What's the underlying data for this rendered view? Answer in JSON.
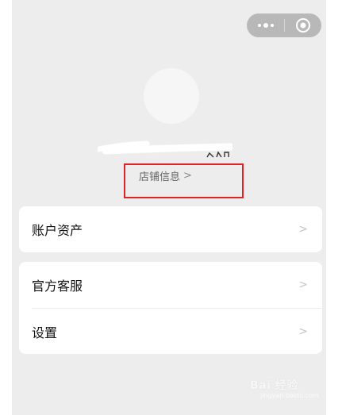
{
  "header": {
    "more_glyph": "•••",
    "close_glyph": "◎"
  },
  "profile": {
    "store_info_label": "店铺信息",
    "store_info_chevron": ">"
  },
  "menu": {
    "assets_label": "账户资产",
    "service_label": "官方客服",
    "settings_label": "设置",
    "chevron": ">"
  },
  "watermark": {
    "main": "Bai 经验",
    "sub": "jingyan.baidu.com"
  },
  "colors": {
    "background": "#ededed",
    "card": "#ffffff",
    "highlight": "#e02424",
    "capsule": "#b8b8b8"
  }
}
